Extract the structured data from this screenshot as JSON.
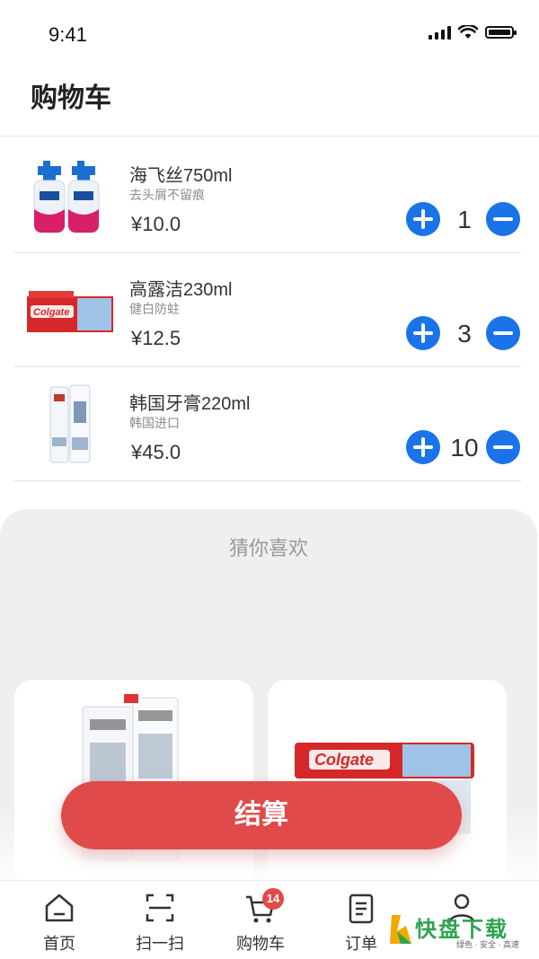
{
  "status": {
    "time": "9:41"
  },
  "header": {
    "title": "购物车"
  },
  "cart": {
    "items": [
      {
        "name": "海飞丝750ml",
        "desc": "去头屑不留痕",
        "price": "¥10.0",
        "qty": "1"
      },
      {
        "name": "高露洁230ml",
        "desc": "健白防蛀",
        "price": "¥12.5",
        "qty": "3"
      },
      {
        "name": "韩国牙膏220ml",
        "desc": "韩国进口",
        "price": "¥45.0",
        "qty": "10"
      }
    ]
  },
  "recommend": {
    "title": "猜你喜欢"
  },
  "checkout": {
    "label": "结算"
  },
  "tabbar": {
    "items": [
      {
        "label": "首页",
        "icon": "home-icon"
      },
      {
        "label": "扫一扫",
        "icon": "scan-icon"
      },
      {
        "label": "购物车",
        "icon": "cart-icon",
        "badge": "14"
      },
      {
        "label": "订单",
        "icon": "order-icon"
      },
      {
        "label": "我的",
        "icon": "user-icon"
      }
    ]
  },
  "watermark": {
    "main": "快盘下载",
    "sub": "绿色 · 安全 · 高速"
  },
  "colors": {
    "accent": "#1a73e8",
    "checkout": "#e04a4a",
    "watermark": "#2ea44f"
  }
}
